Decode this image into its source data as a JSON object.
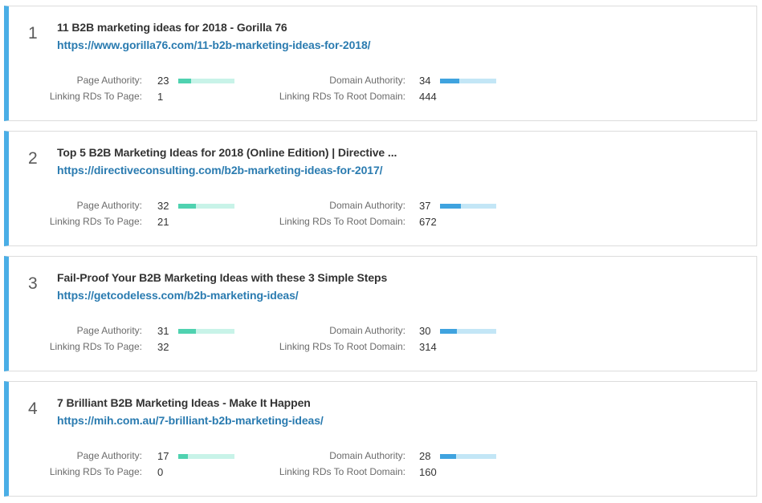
{
  "labels": {
    "page_authority": "Page Authority:",
    "linking_rds_page": "Linking RDs To Page:",
    "domain_authority": "Domain Authority:",
    "linking_rds_root": "Linking RDs To Root Domain:"
  },
  "colors": {
    "accent_border": "#4aaee6",
    "url": "#2a7bb0",
    "pa_bar_fill": "#4fd2b0",
    "pa_bar_track": "#c8f3e8",
    "da_bar_fill": "#3fa3df",
    "da_bar_track": "#c3e6f6"
  },
  "results": [
    {
      "rank": "1",
      "title": "11 B2B marketing ideas for 2018 - Gorilla 76",
      "url": "https://www.gorilla76.com/11-b2b-marketing-ideas-for-2018/",
      "page_authority": "23",
      "linking_rds_page": "1",
      "domain_authority": "34",
      "linking_rds_root": "444",
      "pa_bar_fraction": 0.23,
      "da_bar_fraction": 0.34
    },
    {
      "rank": "2",
      "title": "Top 5 B2B Marketing Ideas for 2018 (Online Edition) | Directive ...",
      "url": "https://directiveconsulting.com/b2b-marketing-ideas-for-2017/",
      "page_authority": "32",
      "linking_rds_page": "21",
      "domain_authority": "37",
      "linking_rds_root": "672",
      "pa_bar_fraction": 0.32,
      "da_bar_fraction": 0.37
    },
    {
      "rank": "3",
      "title": "Fail-Proof Your B2B Marketing Ideas with these 3 Simple Steps",
      "url": "https://getcodeless.com/b2b-marketing-ideas/",
      "page_authority": "31",
      "linking_rds_page": "32",
      "domain_authority": "30",
      "linking_rds_root": "314",
      "pa_bar_fraction": 0.31,
      "da_bar_fraction": 0.3
    },
    {
      "rank": "4",
      "title": "7 Brilliant B2B Marketing Ideas - Make It Happen",
      "url": "https://mih.com.au/7-brilliant-b2b-marketing-ideas/",
      "page_authority": "17",
      "linking_rds_page": "0",
      "domain_authority": "28",
      "linking_rds_root": "160",
      "pa_bar_fraction": 0.17,
      "da_bar_fraction": 0.28
    }
  ]
}
